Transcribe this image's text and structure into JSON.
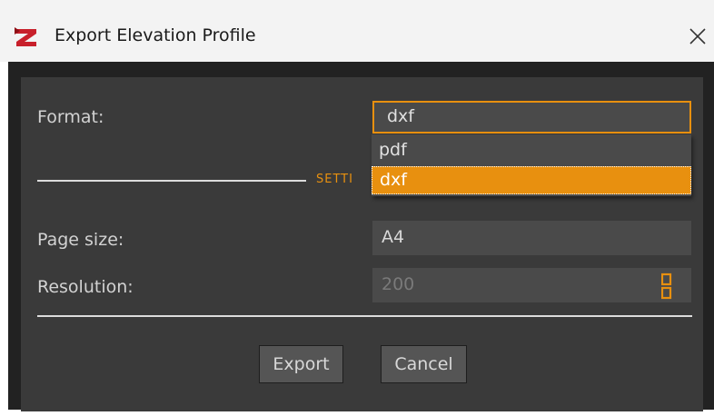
{
  "window": {
    "title": "Export Elevation Profile",
    "close_glyph": "✕",
    "app_icon": "app-logo-icon",
    "accent_color": "#e8900f"
  },
  "form": {
    "format_label": "Format:",
    "format_value": "dxf",
    "section_title": "SETTI",
    "page_size_label": "Page size:",
    "page_size_value": "A4",
    "resolution_label": "Resolution:",
    "resolution_value": "200"
  },
  "dropdown": {
    "options": [
      "pdf",
      "dxf"
    ],
    "selected": "dxf"
  },
  "buttons": {
    "export": "Export",
    "cancel": "Cancel"
  }
}
